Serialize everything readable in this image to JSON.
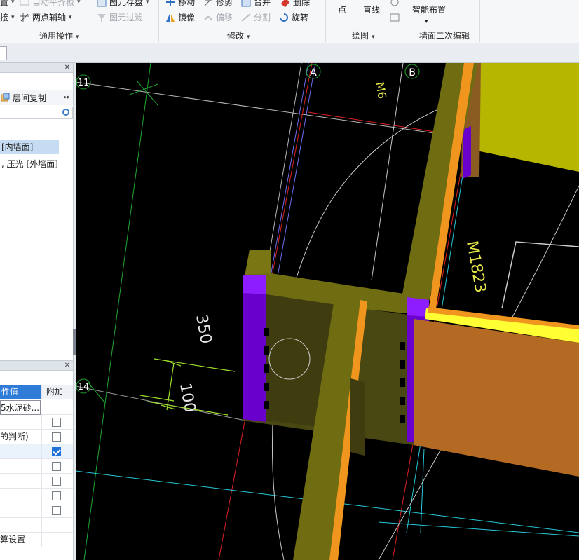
{
  "ribbon": {
    "general_ops": {
      "group_label": "通用操作",
      "items": [
        {
          "label": "置",
          "disabled": false
        },
        {
          "label": "自动平齐板",
          "disabled": true
        },
        {
          "label": "图元存盘",
          "disabled": false
        },
        {
          "label": "接",
          "disabled": false
        },
        {
          "label": "两点辅轴",
          "disabled": false
        },
        {
          "label": "图元过滤",
          "disabled": true
        }
      ]
    },
    "modify": {
      "group_label": "修改",
      "items": [
        {
          "label": "移动",
          "disabled": false
        },
        {
          "label": "修剪",
          "disabled": false
        },
        {
          "label": "合并",
          "disabled": false
        },
        {
          "label": "删除",
          "disabled": false
        },
        {
          "label": "镜像",
          "disabled": false
        },
        {
          "label": "偏移",
          "disabled": true
        },
        {
          "label": "分割",
          "disabled": true
        },
        {
          "label": "旋转",
          "disabled": false
        }
      ]
    },
    "draw": {
      "group_label": "绘图",
      "items": [
        {
          "label": "点"
        },
        {
          "label": "直线"
        }
      ]
    },
    "wall_edit": {
      "group_label": "墙面二次编辑",
      "items": [
        {
          "label": "智能布置"
        }
      ]
    }
  },
  "left_panel": {
    "copy_label": "层间复制",
    "tree_items": [
      {
        "label": "[内墙面]",
        "selected": true
      },
      {
        "label": ", 压光 [外墙面]",
        "selected": false
      }
    ]
  },
  "properties": {
    "col_value": "性值",
    "col_extra": "附加",
    "rows": [
      {
        "value": "5水泥砂...",
        "checkbox": null
      },
      {
        "value": "",
        "checkbox": false
      },
      {
        "value": "的判断)",
        "checkbox": false
      },
      {
        "value": "",
        "checkbox": true
      },
      {
        "value": "",
        "checkbox": false
      },
      {
        "value": "",
        "checkbox": false
      },
      {
        "value": "",
        "checkbox": false
      },
      {
        "value": "",
        "checkbox": false
      },
      {
        "value": "",
        "checkbox": null
      },
      {
        "value": "算设置",
        "checkbox": null
      }
    ]
  },
  "drawing": {
    "axes": [
      "A",
      "B",
      "11",
      "14"
    ],
    "dimension_350": "350",
    "dimension_100": "100",
    "door_label": "M1823",
    "window_label": "M6"
  }
}
